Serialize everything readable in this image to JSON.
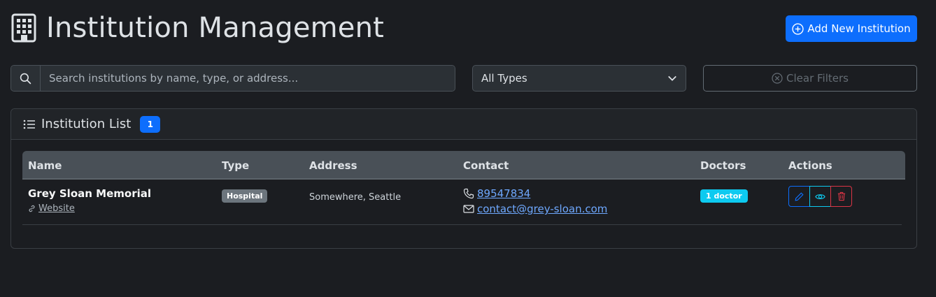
{
  "header": {
    "title": "Institution Management",
    "add_button_label": "Add New Institution"
  },
  "filters": {
    "search_placeholder": "Search institutions by name, type, or address...",
    "type_selected": "All Types",
    "clear_label": "Clear Filters"
  },
  "list": {
    "title": "Institution List",
    "count": "1",
    "columns": [
      "Name",
      "Type",
      "Address",
      "Contact",
      "Doctors",
      "Actions"
    ],
    "rows": [
      {
        "name": "Grey Sloan Memorial",
        "website_label": "Website",
        "type": "Hospital",
        "address": "Somewhere, Seattle",
        "phone": "89547834",
        "email": "contact@grey-sloan.com",
        "doctors": "1 doctor"
      }
    ]
  },
  "colors": {
    "background": "#1b1d21",
    "primary": "#0d6efd",
    "info": "#0dcaf0",
    "danger": "#dc3545",
    "secondary": "#6c757d"
  }
}
